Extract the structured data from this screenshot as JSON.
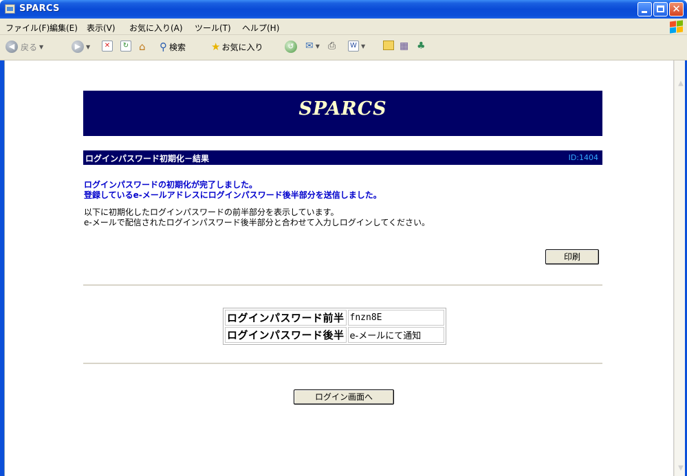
{
  "window": {
    "title": "SPARCS"
  },
  "menu": {
    "items": [
      "ファイル(F)",
      "編集(E)",
      "表示(V)",
      "お気に入り(A)",
      "ツール(T)",
      "ヘルプ(H)"
    ]
  },
  "toolbar": {
    "back_label": "戻る",
    "search_label": "検索",
    "favorites_label": "お気に入り"
  },
  "page": {
    "banner_title": "SPARCS",
    "section_title": "ログインパスワード初期化－結果",
    "screen_id": "ID:1404",
    "message_line1": "ログインパスワードの初期化が完了しました。",
    "message_line2": "登録しているe-メールアドレスにログインパスワード後半部分を送信しました。",
    "info_line1": "以下に初期化したログインパスワードの前半部分を表示しています。",
    "info_line2": "e-メールで配信されたログインパスワード後半部分と合わせて入力しログインしてください。",
    "print_button": "印刷",
    "password_table": {
      "row1_label": "ログインパスワード前半",
      "row1_value": "fnzn8E",
      "row2_label": "ログインパスワード後半",
      "row2_value": "e-メールにて通知"
    },
    "login_button": "ログイン画面へ"
  },
  "colors": {
    "banner_bg": "#000066",
    "banner_text": "#ffffcc",
    "message_blue": "#0000cc",
    "id_text": "#33aaff"
  }
}
